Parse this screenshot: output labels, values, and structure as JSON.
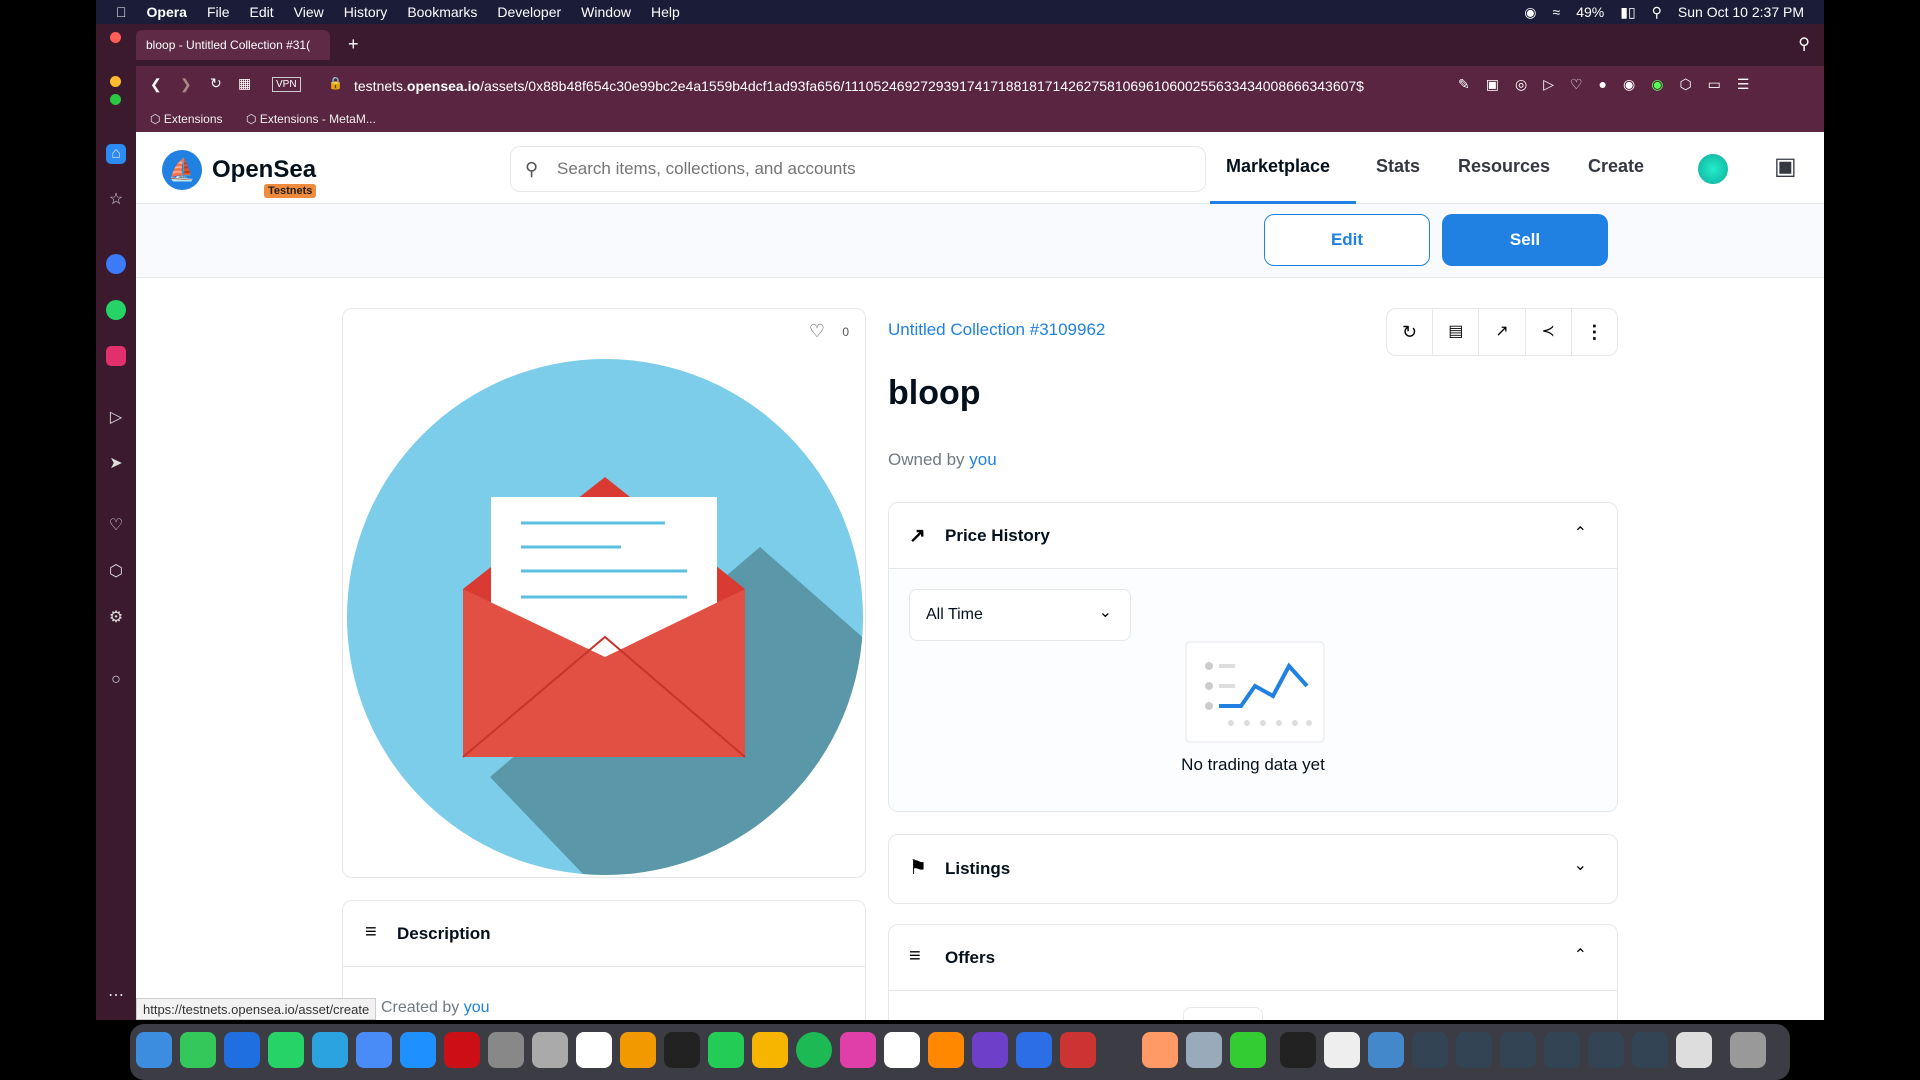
{
  "menubar": {
    "app": "Opera",
    "items": [
      "File",
      "Edit",
      "View",
      "History",
      "Bookmarks",
      "Developer",
      "Window",
      "Help"
    ],
    "battery": "49%",
    "datetime": "Sun Oct 10  2:37 PM"
  },
  "browser": {
    "tab_title": "bloop - Untitled Collection #31(",
    "url_prefix": "testnets.",
    "url_domain": "opensea.io",
    "url_path": "/assets/0x88b48f654c30e99bc2e4a1559b4dcf1ad93fa656/111052469272939174171881817142627581069610600255633434008666343607$",
    "vpn": "VPN",
    "bookmarks": [
      "Extensions",
      "Extensions - MetaM..."
    ],
    "status_url": "https://testnets.opensea.io/asset/create"
  },
  "nav": {
    "logo": "OpenSea",
    "badge": "Testnets",
    "search_placeholder": "Search items, collections, and accounts",
    "links": [
      "Marketplace",
      "Stats",
      "Resources",
      "Create"
    ]
  },
  "actions": {
    "edit": "Edit",
    "sell": "Sell"
  },
  "asset": {
    "favorites": "0",
    "collection": "Untitled Collection #3109962",
    "name": "bloop",
    "owned_by": "Owned by",
    "owner": "you"
  },
  "price_history": {
    "title": "Price History",
    "filter": "All Time",
    "empty": "No trading data yet"
  },
  "listings": {
    "title": "Listings"
  },
  "offers": {
    "title": "Offers"
  },
  "description": {
    "title": "Description",
    "created_by": "Created by",
    "creator": "you"
  },
  "colors": {
    "accent": "#2081e2",
    "brand_bg": "#5a2540"
  }
}
